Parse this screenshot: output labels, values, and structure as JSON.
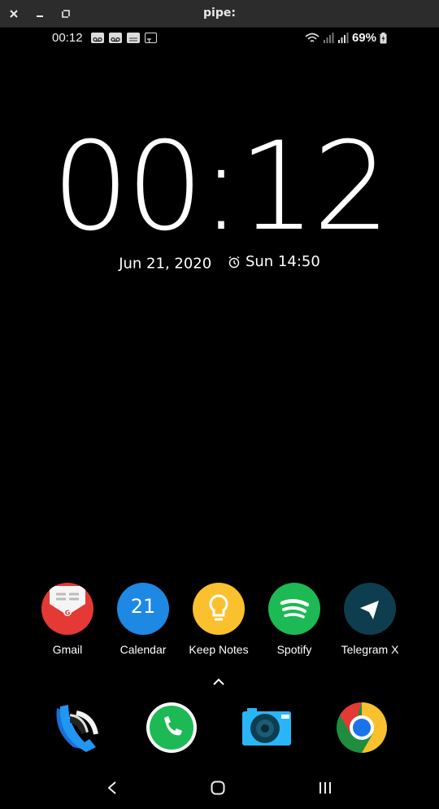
{
  "window": {
    "title": "pipe:"
  },
  "status_bar": {
    "time": "00:12",
    "left_icons": [
      "voicemail-icon",
      "voicemail-icon",
      "rtt-icon",
      "translate-icon"
    ],
    "right_icons": [
      "wifi-icon",
      "signal-icon",
      "signal-icon"
    ],
    "battery_percent": "69%"
  },
  "lock_clock": {
    "time": "00:12",
    "date": "Jun 21, 2020",
    "alarm": "Sun 14:50"
  },
  "apps": [
    {
      "label": "Gmail",
      "icon": "gmail-icon",
      "color": "#e53935"
    },
    {
      "label": "Calendar",
      "icon": "calendar-icon",
      "badge": "21",
      "color": "#1e88e5"
    },
    {
      "label": "Keep Notes",
      "icon": "keep-notes-icon",
      "color": "#fbc02d"
    },
    {
      "label": "Spotify",
      "icon": "spotify-icon",
      "color": "#1db954"
    },
    {
      "label": "Telegram X",
      "icon": "telegram-icon",
      "color": "#0d3d4f"
    }
  ],
  "dock": [
    {
      "icon": "phone-dialer-icon"
    },
    {
      "icon": "phone-icon"
    },
    {
      "icon": "camera-icon"
    },
    {
      "icon": "chrome-icon"
    }
  ],
  "nav": {
    "back_icon": "back-icon",
    "home_icon": "home-icon",
    "recents_icon": "recents-icon"
  }
}
